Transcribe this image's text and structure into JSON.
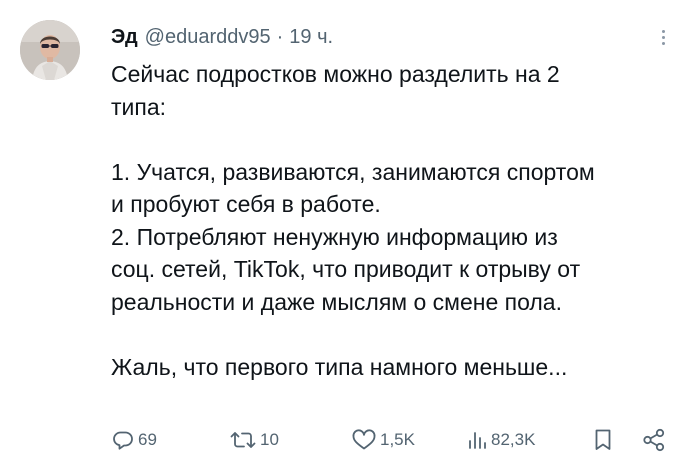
{
  "author": {
    "name": "Эд",
    "handle": "@eduarddv95",
    "separator": "·",
    "time": "19 ч."
  },
  "tweet": {
    "lines": [
      "Сейчас подростков можно разделить на 2",
      "типа:",
      "",
      "1. Учатся, развиваются, занимаются спортом",
      "и пробуют себя в работе.",
      "2. Потребляют ненужную информацию из",
      "соц. сетей, TikTok, что приводит к отрыву от",
      "реальности и даже мыслям о смене пола.",
      "",
      "Жаль, что первого типа намного меньше..."
    ]
  },
  "actions": {
    "replies": "69",
    "retweets": "10",
    "likes": "1,5K",
    "views": "82,3K"
  },
  "icons": {
    "reply": "reply-icon",
    "retweet": "retweet-icon",
    "like": "heart-icon",
    "views": "views-icon",
    "bookmark": "bookmark-icon",
    "share": "share-icon",
    "more": "more-icon"
  },
  "colors": {
    "text": "#0f1419",
    "secondary": "#536471"
  }
}
